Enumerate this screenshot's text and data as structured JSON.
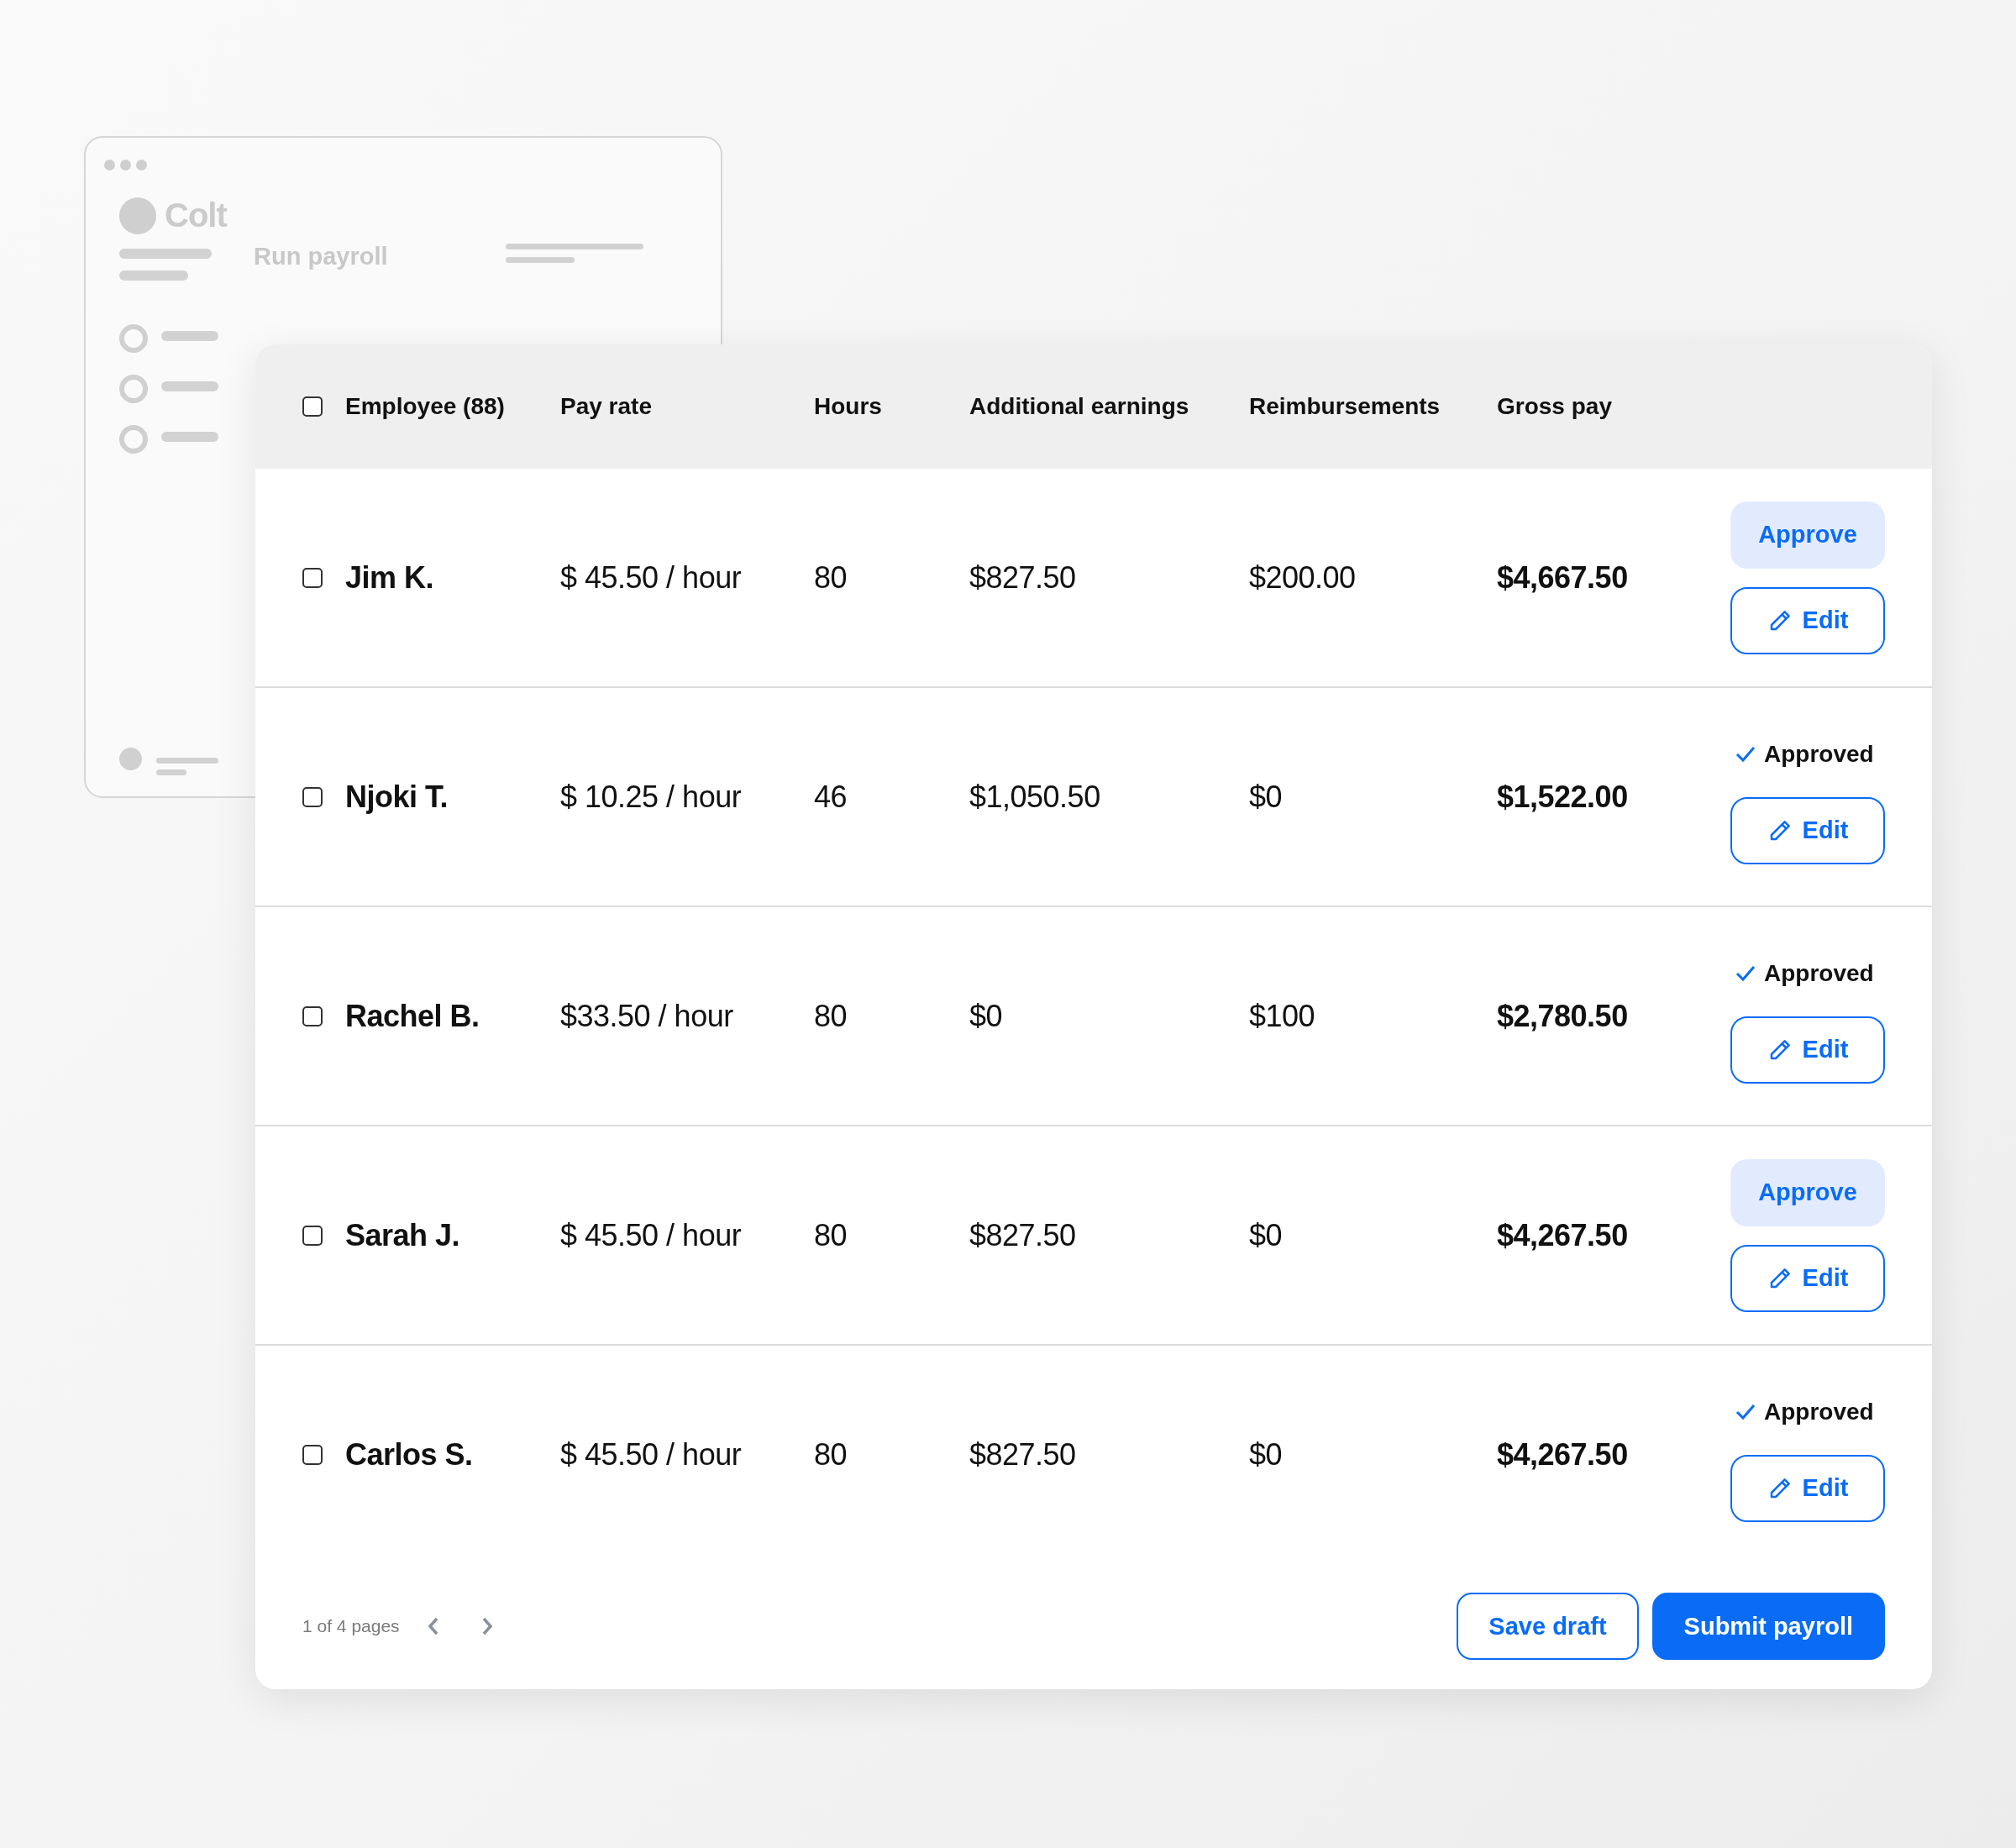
{
  "background_window": {
    "logo": "Colt",
    "title": "Run payroll"
  },
  "table": {
    "select_all": {
      "checked": false
    },
    "columns": [
      "Employee (88)",
      "Pay rate",
      "Hours",
      "Additional earnings",
      "Reimbursements",
      "Gross pay"
    ],
    "rows": [
      {
        "employee": "Jim K.",
        "checked": false,
        "pay_rate": "$ 45.50 / hour",
        "hours": "80",
        "additional_earnings": "$827.50",
        "reimbursements": "$200.00",
        "gross_pay": "$4,667.50",
        "status": {
          "kind": "approve",
          "label": "Approve"
        },
        "action": "Edit"
      },
      {
        "employee": "Njoki T.",
        "checked": false,
        "pay_rate": "$ 10.25 / hour",
        "hours": "46",
        "additional_earnings": "$1,050.50",
        "reimbursements": "$0",
        "gross_pay": "$1,522.00",
        "status": {
          "kind": "approved",
          "label": "Approved"
        },
        "action": "Edit"
      },
      {
        "employee": "Rachel B.",
        "checked": false,
        "pay_rate": "$33.50 / hour",
        "hours": "80",
        "additional_earnings": "$0",
        "reimbursements": "$100",
        "gross_pay": "$2,780.50",
        "status": {
          "kind": "approved",
          "label": "Approved"
        },
        "action": "Edit"
      },
      {
        "employee": "Sarah J.",
        "checked": false,
        "pay_rate": "$ 45.50 / hour",
        "hours": "80",
        "additional_earnings": "$827.50",
        "reimbursements": "$0",
        "gross_pay": "$4,267.50",
        "status": {
          "kind": "approve",
          "label": "Approve"
        },
        "action": "Edit"
      },
      {
        "employee": "Carlos S.",
        "checked": false,
        "pay_rate": "$ 45.50 / hour",
        "hours": "80",
        "additional_earnings": "$827.50",
        "reimbursements": "$0",
        "gross_pay": "$4,267.50",
        "status": {
          "kind": "approved",
          "label": "Approved"
        },
        "action": "Edit"
      }
    ]
  },
  "footer": {
    "page_info": "1 of 4 pages",
    "buttons": [
      {
        "label": "Save draft",
        "kind": "secondary"
      },
      {
        "label": "Submit payroll",
        "kind": "primary"
      }
    ]
  }
}
